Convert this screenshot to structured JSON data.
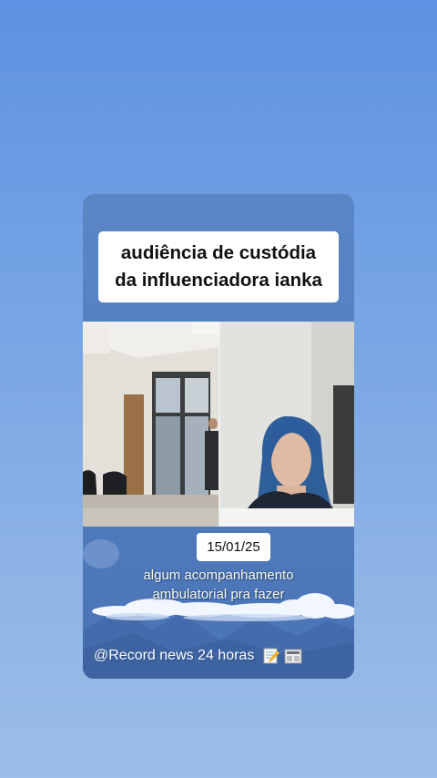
{
  "story": {
    "title_lines": [
      "audiência de custódia",
      "da influenciadora ianka"
    ],
    "date": "15/01/25",
    "caption_lines": [
      "algum acompanhamento",
      "ambulatorial pra fazer"
    ],
    "footer_text": "@Record news 24 horas",
    "footer_icons": [
      "memo-icon",
      "newspaper-icon"
    ]
  }
}
